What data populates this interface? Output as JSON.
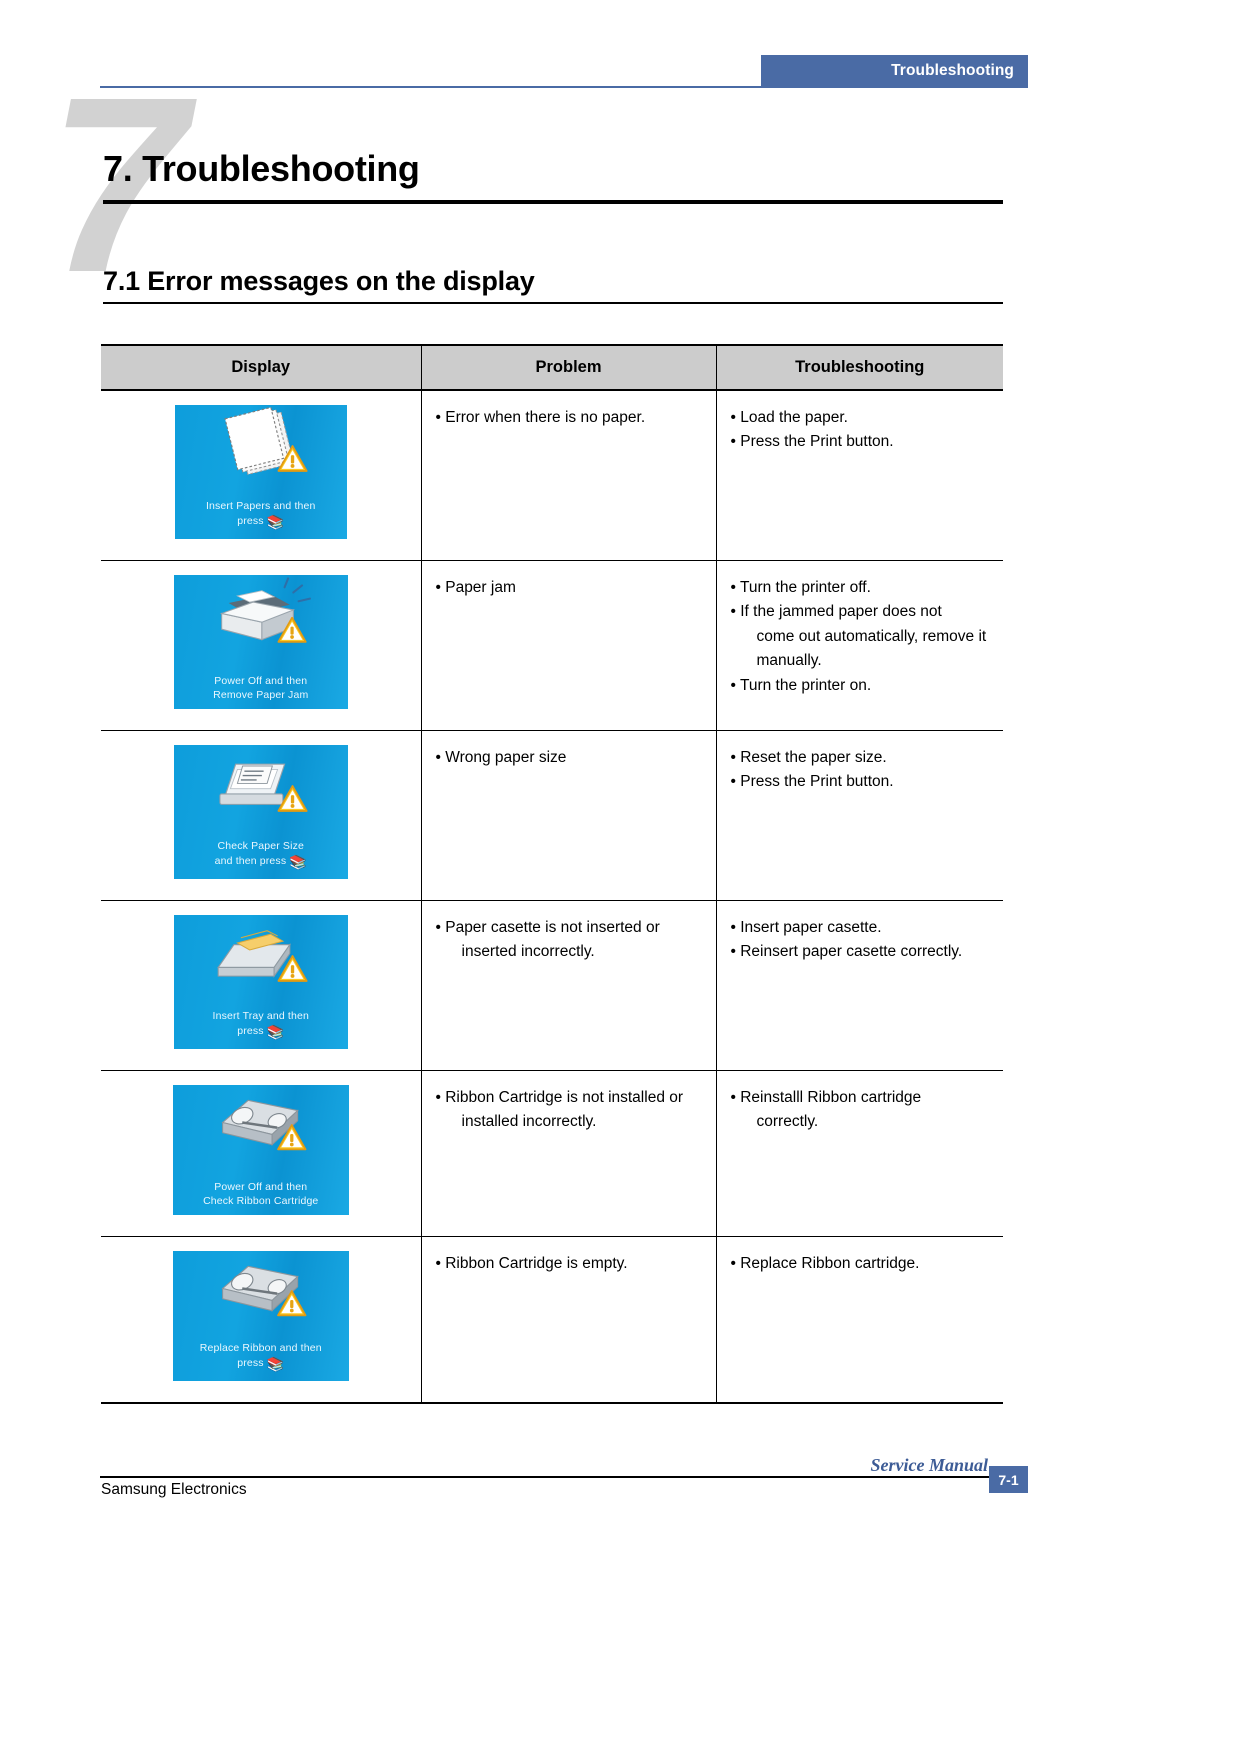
{
  "header": {
    "running_head": "Troubleshooting",
    "accent_color": "#4A6BA5"
  },
  "chapter": {
    "number": "7",
    "title": "7. Troubleshooting",
    "watermark": "7"
  },
  "section": {
    "title": "7.1 Error messages on the display"
  },
  "table": {
    "columns": [
      "Display",
      "Problem",
      "Troubleshooting"
    ],
    "rows": [
      {
        "display": {
          "icon": "paper-stack-warning-icon",
          "caption_line1": "Insert Papers and then",
          "caption_line2": "press",
          "caption_symbol": "return-key-icon",
          "bg_color": "#12A4E0"
        },
        "problem": [
          "• Error when there is no paper."
        ],
        "troubleshooting": [
          "• Load the paper.",
          "• Press the Print button."
        ]
      },
      {
        "display": {
          "icon": "printer-paper-jam-warning-icon",
          "caption_line1": "Power Off and then",
          "caption_line2": "Remove Paper Jam",
          "caption_symbol": "",
          "bg_color": "#12A4E0"
        },
        "problem": [
          "• Paper jam"
        ],
        "troubleshooting": [
          "• Turn the printer off.",
          "• If the jammed paper does not",
          "come out automatically, remove it",
          "manually.",
          "• Turn the printer on."
        ]
      },
      {
        "display": {
          "icon": "paper-size-check-warning-icon",
          "caption_line1": "Check Paper Size",
          "caption_line2": "and then press",
          "caption_symbol": "return-key-icon",
          "bg_color": "#12A4E0"
        },
        "problem": [
          "• Wrong paper size"
        ],
        "troubleshooting": [
          "• Reset the paper size.",
          "• Press the Print button."
        ]
      },
      {
        "display": {
          "icon": "paper-tray-warning-icon",
          "caption_line1": "Insert Tray and then",
          "caption_line2": "press",
          "caption_symbol": "return-key-icon",
          "bg_color": "#12A4E0"
        },
        "problem": [
          "• Paper casette is not inserted or",
          "inserted incorrectly."
        ],
        "troubleshooting": [
          "• Insert paper casette.",
          "• Reinsert paper casette correctly."
        ]
      },
      {
        "display": {
          "icon": "ribbon-cartridge-warning-icon",
          "caption_line1": "Power Off and then",
          "caption_line2": "Check Ribbon Cartridge",
          "caption_symbol": "",
          "bg_color": "#12A4E0"
        },
        "problem": [
          "• Ribbon Cartridge is not installed or",
          "installed incorrectly."
        ],
        "troubleshooting": [
          "• Reinstalll Ribbon cartridge",
          "correctly."
        ]
      },
      {
        "display": {
          "icon": "ribbon-cartridge-replace-warning-icon",
          "caption_line1": "Replace Ribbon and then",
          "caption_line2": "press",
          "caption_symbol": "return-key-icon",
          "bg_color": "#12A4E0"
        },
        "problem": [
          "• Ribbon Cartridge is empty."
        ],
        "troubleshooting": [
          "• Replace Ribbon cartridge."
        ]
      }
    ]
  },
  "footer": {
    "company": "Samsung Electronics",
    "manual": "Service Manual",
    "page": "7-1"
  }
}
